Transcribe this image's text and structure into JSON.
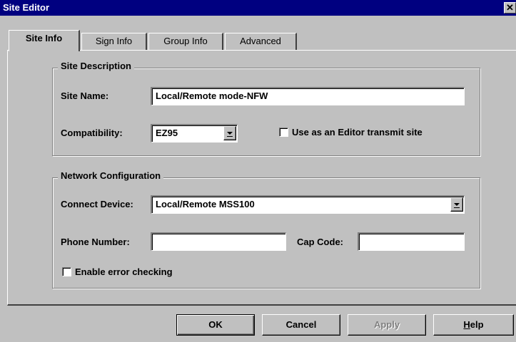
{
  "window": {
    "title": "Site Editor",
    "close_glyph": "✕"
  },
  "tabs": [
    {
      "label": "Site Info",
      "active": true
    },
    {
      "label": "Sign Info",
      "active": false
    },
    {
      "label": "Group Info",
      "active": false
    },
    {
      "label": "Advanced",
      "active": false
    }
  ],
  "site_description": {
    "legend": "Site Description",
    "site_name_label": "Site Name:",
    "site_name_value": "Local/Remote mode-NFW",
    "compatibility_label": "Compatibility:",
    "compatibility_value": "EZ95",
    "editor_transmit_label": "Use as an Editor transmit site",
    "editor_transmit_checked": false
  },
  "network": {
    "legend": "Network Configuration",
    "connect_device_label": "Connect Device:",
    "connect_device_value": "Local/Remote MSS100",
    "phone_label": "Phone Number:",
    "phone_value": "",
    "cap_code_label": "Cap Code:",
    "cap_code_value": "",
    "error_checking_label": "Enable error checking",
    "error_checking_checked": false
  },
  "buttons": {
    "ok": "OK",
    "cancel": "Cancel",
    "apply": "Apply",
    "help_first": "H",
    "help_rest": "elp"
  }
}
